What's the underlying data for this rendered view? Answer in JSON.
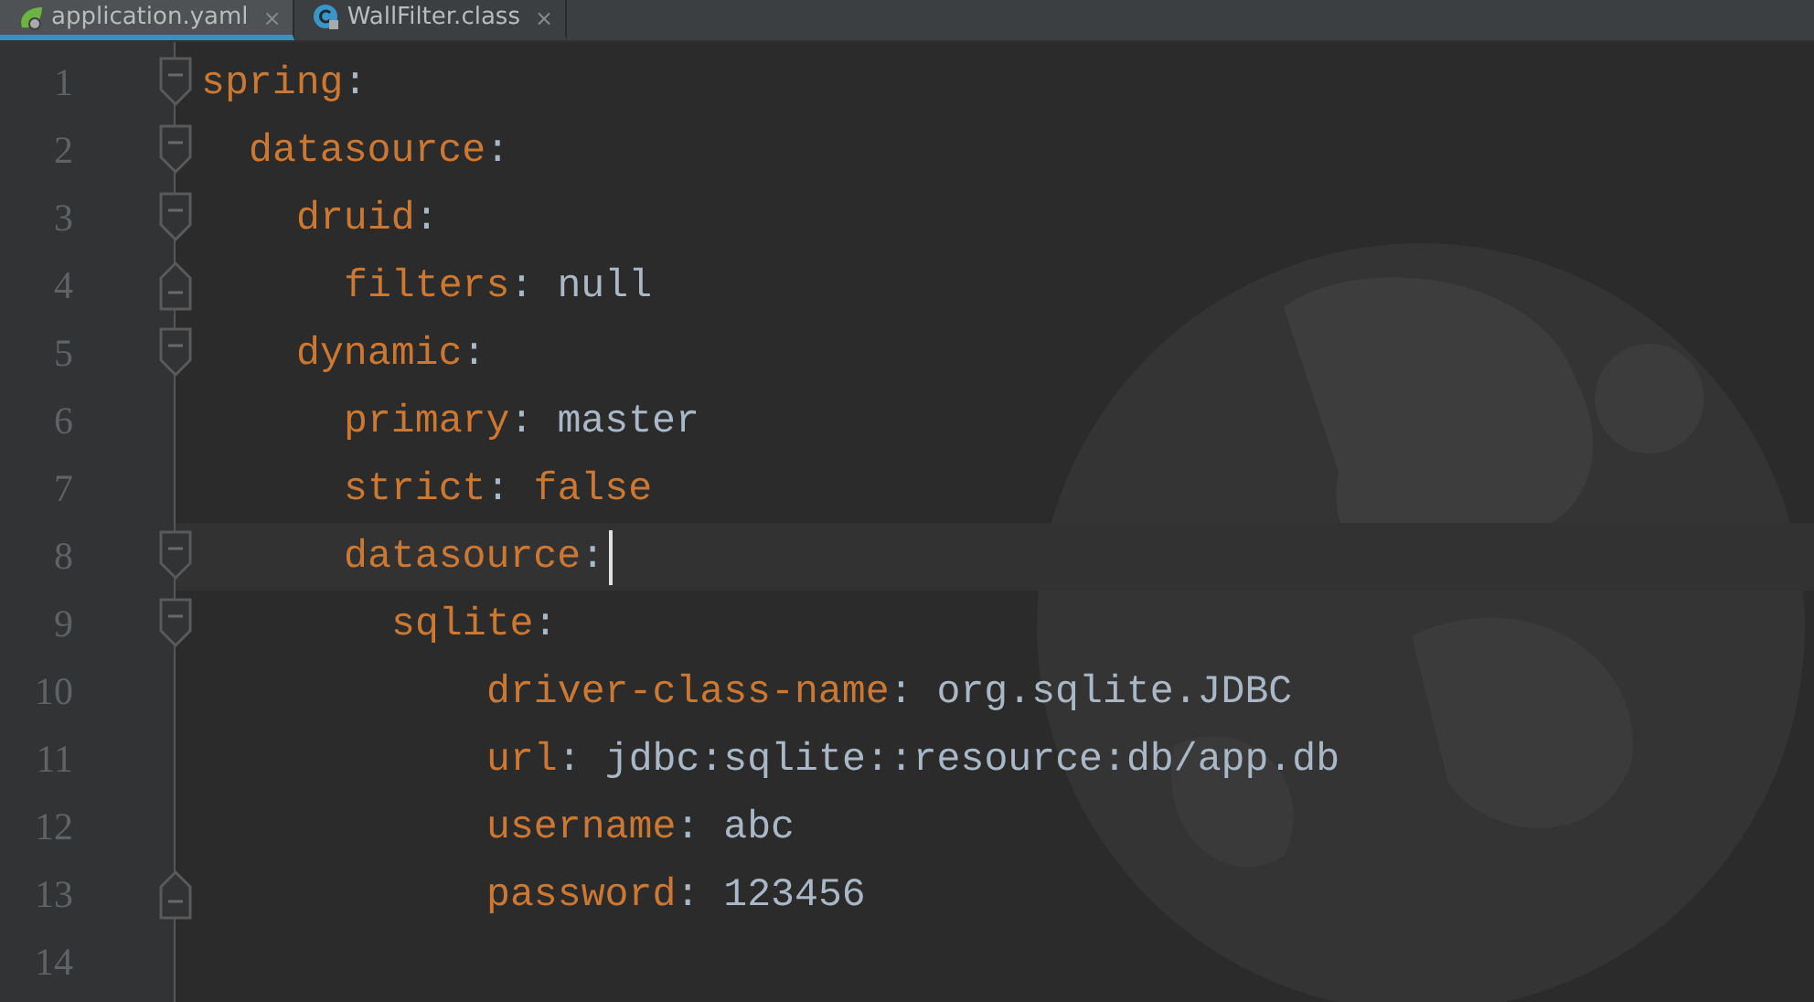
{
  "tabs": [
    {
      "label": "application.yaml",
      "kind": "leaf",
      "selected": true,
      "close": "×"
    },
    {
      "label": "WallFilter.class",
      "kind": "class",
      "selected": false,
      "close": "×"
    }
  ],
  "gutter": [
    {
      "number": "1",
      "kind": "start"
    },
    {
      "number": "2",
      "kind": "start"
    },
    {
      "number": "3",
      "kind": "start"
    },
    {
      "number": "4",
      "kind": "end"
    },
    {
      "number": "5",
      "kind": "start"
    },
    {
      "number": "6",
      "kind": "none"
    },
    {
      "number": "7",
      "kind": "none"
    },
    {
      "number": "8",
      "kind": "start"
    },
    {
      "number": "9",
      "kind": "start"
    },
    {
      "number": "10",
      "kind": "none"
    },
    {
      "number": "11",
      "kind": "none"
    },
    {
      "number": "12",
      "kind": "none"
    },
    {
      "number": "13",
      "kind": "end"
    },
    {
      "number": "14",
      "kind": "none"
    }
  ],
  "code": [
    {
      "key": "spring",
      "colon": ":",
      "children": [
        {
          "key": "datasource",
          "colon": ":",
          "children": [
            {
              "key": "druid",
              "colon": ":",
              "children": [
                {
                  "key": "filters",
                  "colon": ":",
                  "value": "null",
                  "kind": "plain"
                }
              ]
            },
            {
              "key": "dynamic",
              "colon": ":",
              "children": [
                {
                  "key": "primary",
                  "colon": ":",
                  "value": "master",
                  "kind": "plain"
                },
                {
                  "key": "strict",
                  "colon": ":",
                  "value": "false",
                  "kind": "keyword"
                },
                {
                  "key": "datasource",
                  "colon": ":",
                  "cursor": true,
                  "children": [
                    {
                      "key": "sqlite",
                      "colon": ":",
                      "deep_indent": true,
                      "children": [
                        {
                          "key": "driver-class-name",
                          "colon": ":",
                          "value": "org.sqlite.JDBC",
                          "kind": "plain"
                        },
                        {
                          "key": "url",
                          "colon": ":",
                          "value": "jdbc:sqlite::resource:db/app.db",
                          "kind": "plain"
                        },
                        {
                          "key": "username",
                          "colon": ":",
                          "value": "abc",
                          "kind": "plain"
                        },
                        {
                          "key": "password",
                          "colon": ":",
                          "value": "123456",
                          "kind": "plain"
                        }
                      ]
                    }
                  ]
                }
              ]
            }
          ]
        }
      ]
    }
  ]
}
